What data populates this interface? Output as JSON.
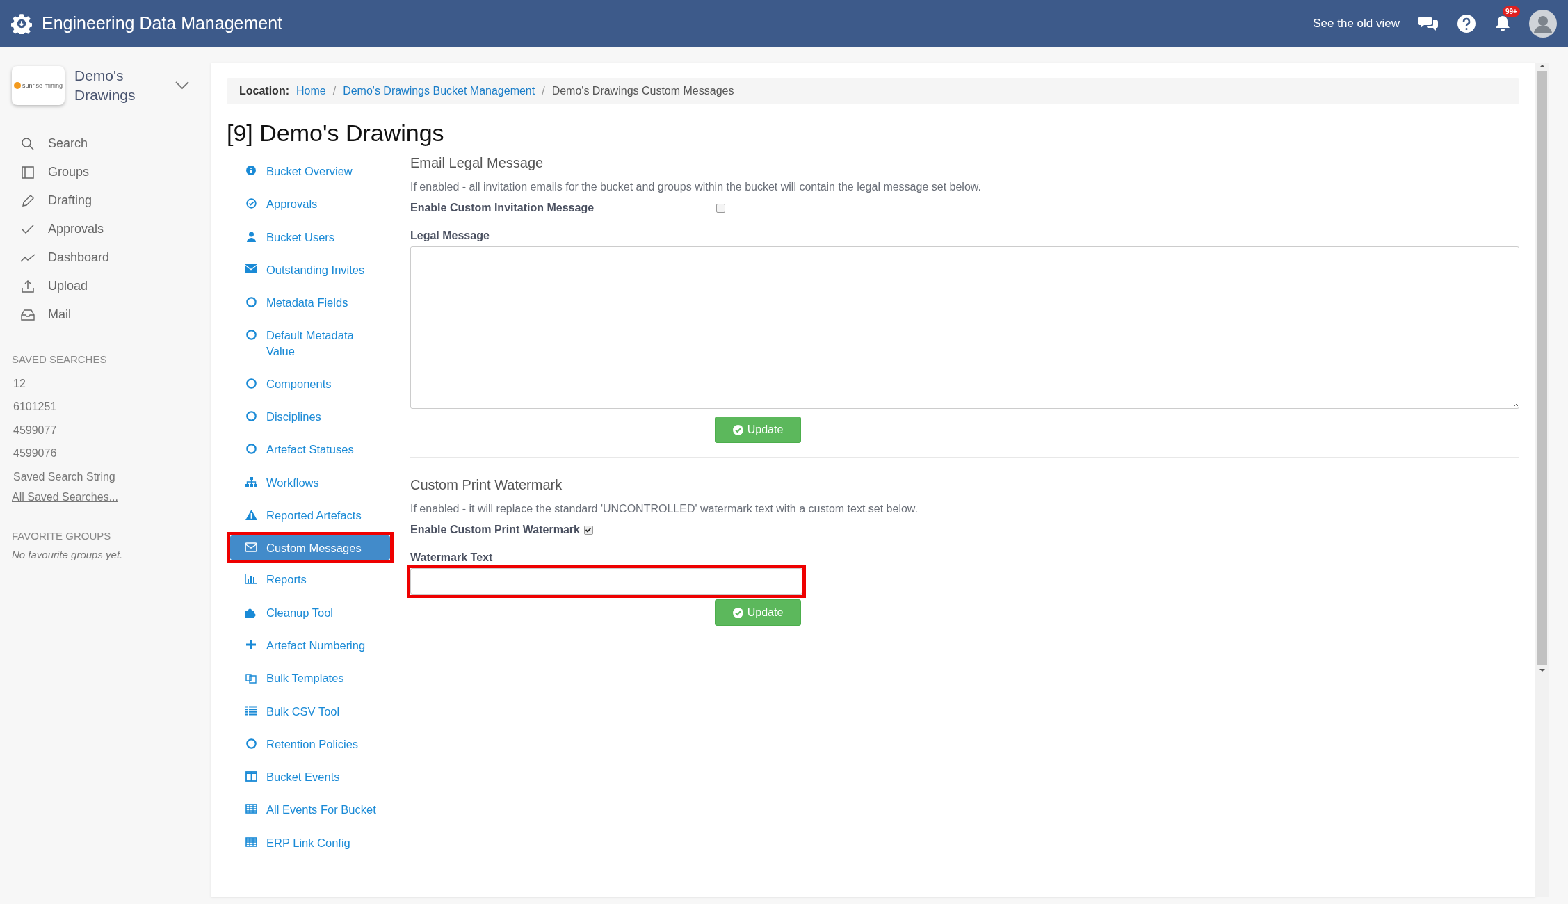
{
  "app_title": "Engineering Data Management",
  "top_actions": {
    "old_view_link": "See the old view",
    "notification_badge": "99+"
  },
  "bucket_switcher": {
    "name": "Demo's Drawings",
    "logo_text": "sunrise mining"
  },
  "nav": [
    {
      "label": "Search",
      "kind": "search"
    },
    {
      "label": "Groups",
      "kind": "groups"
    },
    {
      "label": "Drafting",
      "kind": "pencil"
    },
    {
      "label": "Approvals",
      "kind": "check"
    },
    {
      "label": "Dashboard",
      "kind": "trend"
    },
    {
      "label": "Upload",
      "kind": "upload"
    },
    {
      "label": "Mail",
      "kind": "inbox"
    }
  ],
  "saved_searches": {
    "heading": "SAVED SEARCHES",
    "items": [
      "12",
      "6101251",
      "4599077",
      "4599076",
      "Saved Search String"
    ],
    "all_link": "All Saved Searches..."
  },
  "favorite_groups": {
    "heading": "FAVORITE GROUPS",
    "empty_text": "No favourite groups yet."
  },
  "breadcrumb": {
    "label": "Location:",
    "links": [
      "Home",
      "Demo's Drawings Bucket Management"
    ],
    "separator": "/",
    "current": "Demo's Drawings Custom Messages"
  },
  "page_title": "[9] Demo's Drawings",
  "bucket_menu": [
    {
      "label": "Bucket Overview",
      "kind": "info",
      "selected": false,
      "highlighted": false
    },
    {
      "label": "Approvals",
      "kind": "check-circle",
      "selected": false,
      "highlighted": false
    },
    {
      "label": "Bucket Users",
      "kind": "user",
      "selected": false,
      "highlighted": false
    },
    {
      "label": "Outstanding Invites",
      "kind": "envelope",
      "selected": false,
      "highlighted": false
    },
    {
      "label": "Metadata Fields",
      "kind": "circle",
      "selected": false,
      "highlighted": false
    },
    {
      "label": "Default Metadata Value",
      "kind": "circle",
      "selected": false,
      "highlighted": false
    },
    {
      "label": "Components",
      "kind": "circle",
      "selected": false,
      "highlighted": false
    },
    {
      "label": "Disciplines",
      "kind": "circle",
      "selected": false,
      "highlighted": false
    },
    {
      "label": "Artefact Statuses",
      "kind": "circle",
      "selected": false,
      "highlighted": false
    },
    {
      "label": "Workflows",
      "kind": "sitemap",
      "selected": false,
      "highlighted": false
    },
    {
      "label": "Reported Artefacts",
      "kind": "warning",
      "selected": false,
      "highlighted": false
    },
    {
      "label": "Custom Messages",
      "kind": "envelope-outline",
      "selected": true,
      "highlighted": true
    },
    {
      "label": "Reports",
      "kind": "bar-chart",
      "selected": false,
      "highlighted": false
    },
    {
      "label": "Cleanup Tool",
      "kind": "puzzle",
      "selected": false,
      "highlighted": false
    },
    {
      "label": "Artefact Numbering",
      "kind": "plus",
      "selected": false,
      "highlighted": false
    },
    {
      "label": "Bulk Templates",
      "kind": "copy",
      "selected": false,
      "highlighted": false
    },
    {
      "label": "Bulk CSV Tool",
      "kind": "list",
      "selected": false,
      "highlighted": false
    },
    {
      "label": "Retention Policies",
      "kind": "circle",
      "selected": false,
      "highlighted": false
    },
    {
      "label": "Bucket Events",
      "kind": "columns",
      "selected": false,
      "highlighted": false
    },
    {
      "label": "All Events For Bucket",
      "kind": "table",
      "selected": false,
      "highlighted": false
    },
    {
      "label": "ERP Link Config",
      "kind": "table",
      "selected": false,
      "highlighted": false
    }
  ],
  "sections": [
    {
      "title": "Email Legal Message",
      "description": "If enabled - all invitation emails for the bucket and groups within the bucket will contain the legal message set below.",
      "toggle_label": "Enable Custom Invitation Message",
      "checked": false,
      "field": {
        "label": "Legal Message",
        "kind": "textarea",
        "highlighted": false
      },
      "button": "Update"
    },
    {
      "title": "Custom Print Watermark",
      "description": "If enabled - it will replace the standard 'UNCONTROLLED' watermark text with a custom text set below.",
      "toggle_label": "Enable Custom Print Watermark",
      "checked": true,
      "field": {
        "label": "Watermark Text",
        "kind": "input",
        "highlighted": true
      },
      "button": "Update"
    }
  ]
}
